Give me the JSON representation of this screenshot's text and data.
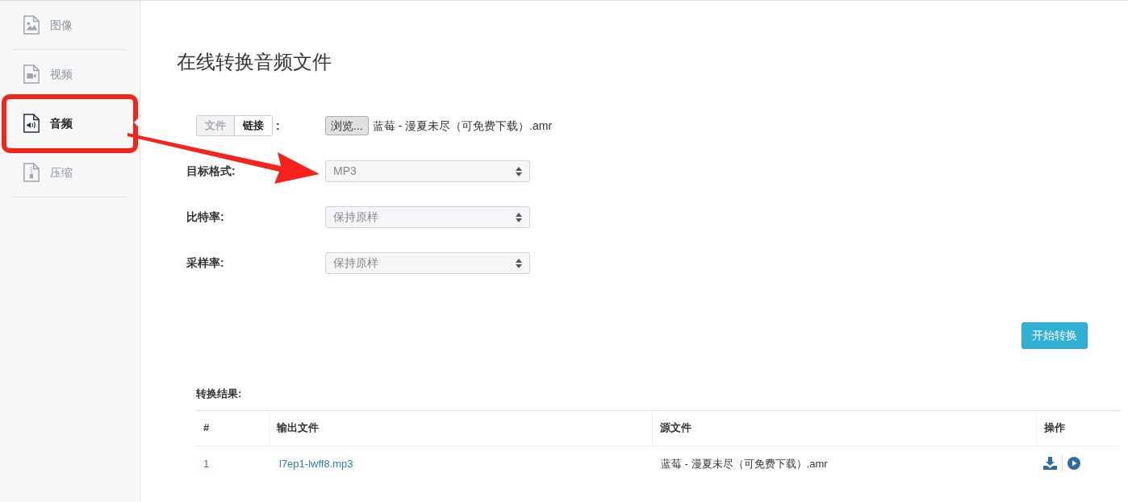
{
  "sidebar": {
    "items": [
      {
        "kind": "image",
        "label": "图像",
        "selected": false
      },
      {
        "kind": "video",
        "label": "视频",
        "selected": false
      },
      {
        "kind": "audio",
        "label": "音频",
        "selected": true
      },
      {
        "kind": "archive",
        "label": "压缩",
        "selected": false
      }
    ]
  },
  "title": "在线转换音频文件",
  "source": {
    "tabs": [
      {
        "label": "文件",
        "selected": true
      },
      {
        "label": "链接",
        "selected": false
      }
    ],
    "colon": ":",
    "browse_button": "浏览...",
    "file_name": "蓝莓 - 漫夏未尽（可免费下载）.amr"
  },
  "fields": [
    {
      "label": "目标格式:",
      "value": "MP3"
    },
    {
      "label": "比特率:",
      "value": "保持原样"
    },
    {
      "label": "采样率:",
      "value": "保持原样"
    }
  ],
  "start_button": "开始转换",
  "results": {
    "heading": "转换结果:",
    "columns": [
      "#",
      "输出文件",
      "源文件",
      "操作"
    ],
    "rows": [
      {
        "index": "1",
        "output": "l7ep1-lwff8.mp3",
        "source": "蓝莓 - 漫夏未尽（可免费下载）.amr"
      }
    ]
  }
}
